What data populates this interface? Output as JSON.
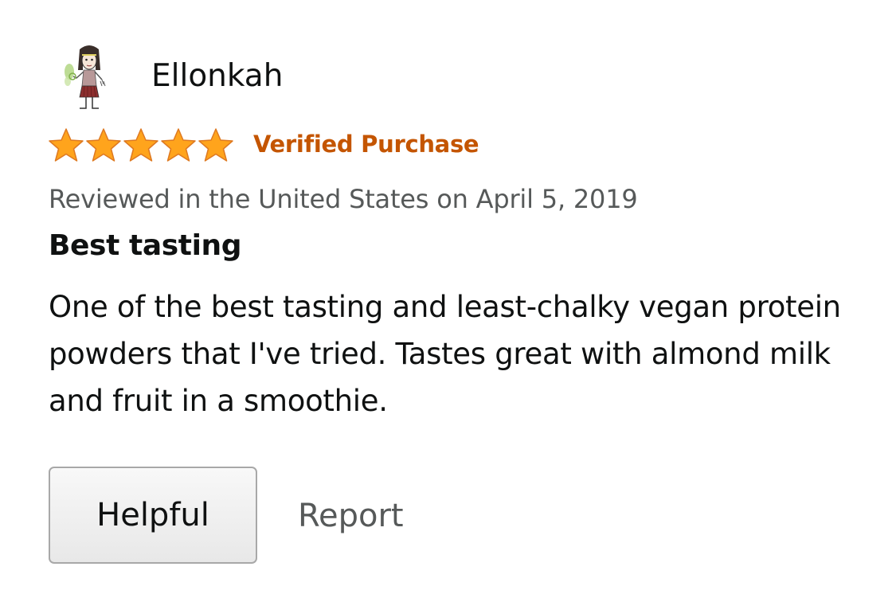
{
  "review": {
    "reviewer_name": "Ellonkah",
    "rating": 5,
    "rating_max": 5,
    "verified_label": "Verified Purchase",
    "meta": "Reviewed in the United States on April 5, 2019",
    "title": "Best tasting",
    "body": "One of the best tasting and least-chalky vegan protein powders that I've tried. Tastes great with almond milk and fruit in a smoothie."
  },
  "actions": {
    "helpful_label": "Helpful",
    "report_label": "Report"
  },
  "colors": {
    "verified": "#c45500",
    "star_fill": "#ffa41c",
    "star_stroke": "#de7921",
    "meta_text": "#565959"
  },
  "icons": {
    "avatar": "cartoon-person-avatar-icon",
    "star": "star-icon"
  }
}
